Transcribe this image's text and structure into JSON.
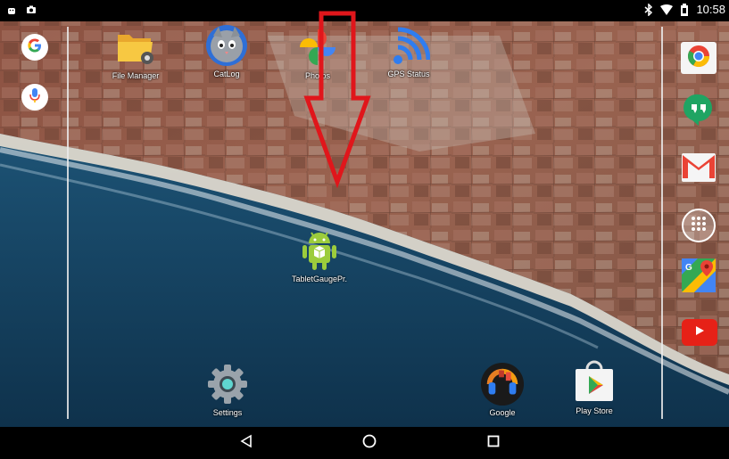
{
  "status_bar": {
    "time": "10:58",
    "left_icons": [
      "android-icon",
      "camera-icon"
    ],
    "right_icons": [
      "bluetooth-icon",
      "wifi-icon",
      "battery-icon"
    ]
  },
  "left_bar": {
    "items": [
      {
        "icon": "google-search-icon"
      },
      {
        "icon": "microphone-icon"
      }
    ]
  },
  "top_apps": [
    {
      "label": "File Manager",
      "icon": "folder-icon"
    },
    {
      "label": "CatLog",
      "icon": "cat-icon"
    },
    {
      "label": "Photos",
      "icon": "photos-pinwheel-icon"
    },
    {
      "label": "GPS Status",
      "icon": "gps-signal-icon"
    }
  ],
  "center_app": {
    "label": "TabletGaugePr.",
    "icon": "android-robot-icon"
  },
  "bottom_apps": [
    {
      "label": "Settings",
      "icon": "settings-gear-icon"
    },
    {
      "label": "Google",
      "icon": "google-music-icon"
    },
    {
      "label": "Play Store",
      "icon": "play-store-icon"
    }
  ],
  "right_dock": [
    {
      "icon": "chrome-icon"
    },
    {
      "icon": "hangouts-icon"
    },
    {
      "icon": "gmail-icon"
    },
    {
      "icon": "app-drawer-icon"
    },
    {
      "icon": "maps-icon"
    },
    {
      "icon": "youtube-icon"
    }
  ],
  "navigation": [
    {
      "icon": "back-icon"
    },
    {
      "icon": "home-icon"
    },
    {
      "icon": "recents-icon"
    }
  ],
  "colors": {
    "annotation_arrow": "#e0161b",
    "status_bar_bg": "#000000",
    "nav_bar_bg": "#000000"
  }
}
